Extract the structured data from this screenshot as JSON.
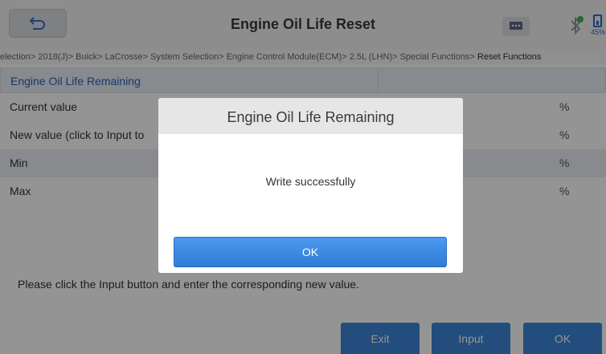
{
  "header": {
    "title": "Engine Oil Life Reset",
    "back_icon": "back-arrow-icon",
    "message_icon": "chat-icon",
    "bluetooth_icon": "bluetooth-icon",
    "battery_percent": "45%"
  },
  "breadcrumb": {
    "path": "election> 2018(J)> Buick> LaCrosse> System Selection> Engine Control Module(ECM)> 2.5L (LHN)> Special Functions> ",
    "current": "Reset Functions"
  },
  "table": {
    "header": "Engine Oil Life Remaining",
    "rows": [
      {
        "name": "Current value",
        "unit": "%"
      },
      {
        "name": "New value (click to Input to",
        "unit": "%"
      },
      {
        "name": "Min",
        "unit": "%"
      },
      {
        "name": "Max",
        "unit": "%"
      }
    ]
  },
  "hint": "Please click the Input button and enter the corresponding new value.",
  "footer": {
    "exit_label": "Exit",
    "input_label": "Input",
    "ok_label": "OK"
  },
  "dialog": {
    "title": "Engine Oil Life Remaining",
    "message": "Write successfully",
    "ok_label": "OK"
  },
  "colors": {
    "accent": "#3c85d8",
    "header_text": "#2a62b8"
  }
}
